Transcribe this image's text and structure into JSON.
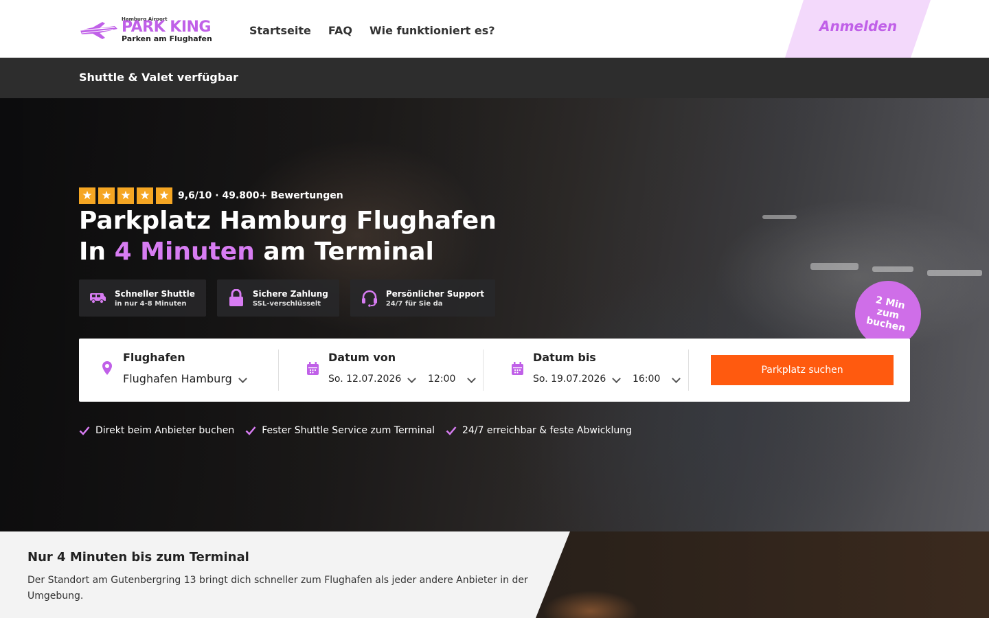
{
  "header": {
    "logo": {
      "top_text": "Hamburg Airport",
      "brand": "PARK KING",
      "tagline": "Parken am Flughafen"
    },
    "nav": [
      {
        "label": "Startseite"
      },
      {
        "label": "FAQ"
      },
      {
        "label": "Wie funktioniert es?"
      }
    ],
    "login_label": "Anmelden"
  },
  "subbar": {
    "text": "Shuttle & Valet verfügbar"
  },
  "hero": {
    "rating": {
      "stars": 5,
      "text": "9,6/10 · 49.800+ Bewertungen"
    },
    "title_line1": "Parkplatz Hamburg Flughafen",
    "title_line2_prefix": "In",
    "title_line2_accent": "4 Minuten",
    "title_line2_suffix": "am Terminal",
    "features": [
      {
        "icon": "shuttle-bus-icon",
        "title": "Schneller Shuttle",
        "subtitle": "in nur 4-8 Minuten"
      },
      {
        "icon": "lock-icon",
        "title": "Sichere Zahlung",
        "subtitle": "SSL-verschlüsselt"
      },
      {
        "icon": "headset-icon",
        "title": "Persönlicher Support",
        "subtitle": "24/7 für Sie da"
      }
    ],
    "badge": "2 Min zum buchen"
  },
  "search": {
    "airport": {
      "label": "Flughafen",
      "value": "Flughafen Hamburg"
    },
    "date_from": {
      "label": "Datum von",
      "date": "So. 12.07.2026",
      "time": "12:00"
    },
    "date_to": {
      "label": "Datum bis",
      "date": "So. 19.07.2026",
      "time": "16:00"
    },
    "button_label": "Parkplatz suchen"
  },
  "checks": [
    {
      "text": "Direkt beim Anbieter buchen"
    },
    {
      "text": "Fester Shuttle Service zum Terminal"
    },
    {
      "text": "24/7 erreichbar & feste Abwicklung"
    }
  ],
  "info": {
    "title": "Nur 4 Minuten bis zum Terminal",
    "text": "Der Standort am Gutenbergring 13 bringt dich schneller zum Flughafen als jeder andere Anbieter in der Umgebung."
  },
  "colors": {
    "accent_purple": "#c060e8",
    "accent_orange": "#ff5a0f",
    "star_color": "#f5a623",
    "subbar_bg": "#2d2d2d"
  }
}
